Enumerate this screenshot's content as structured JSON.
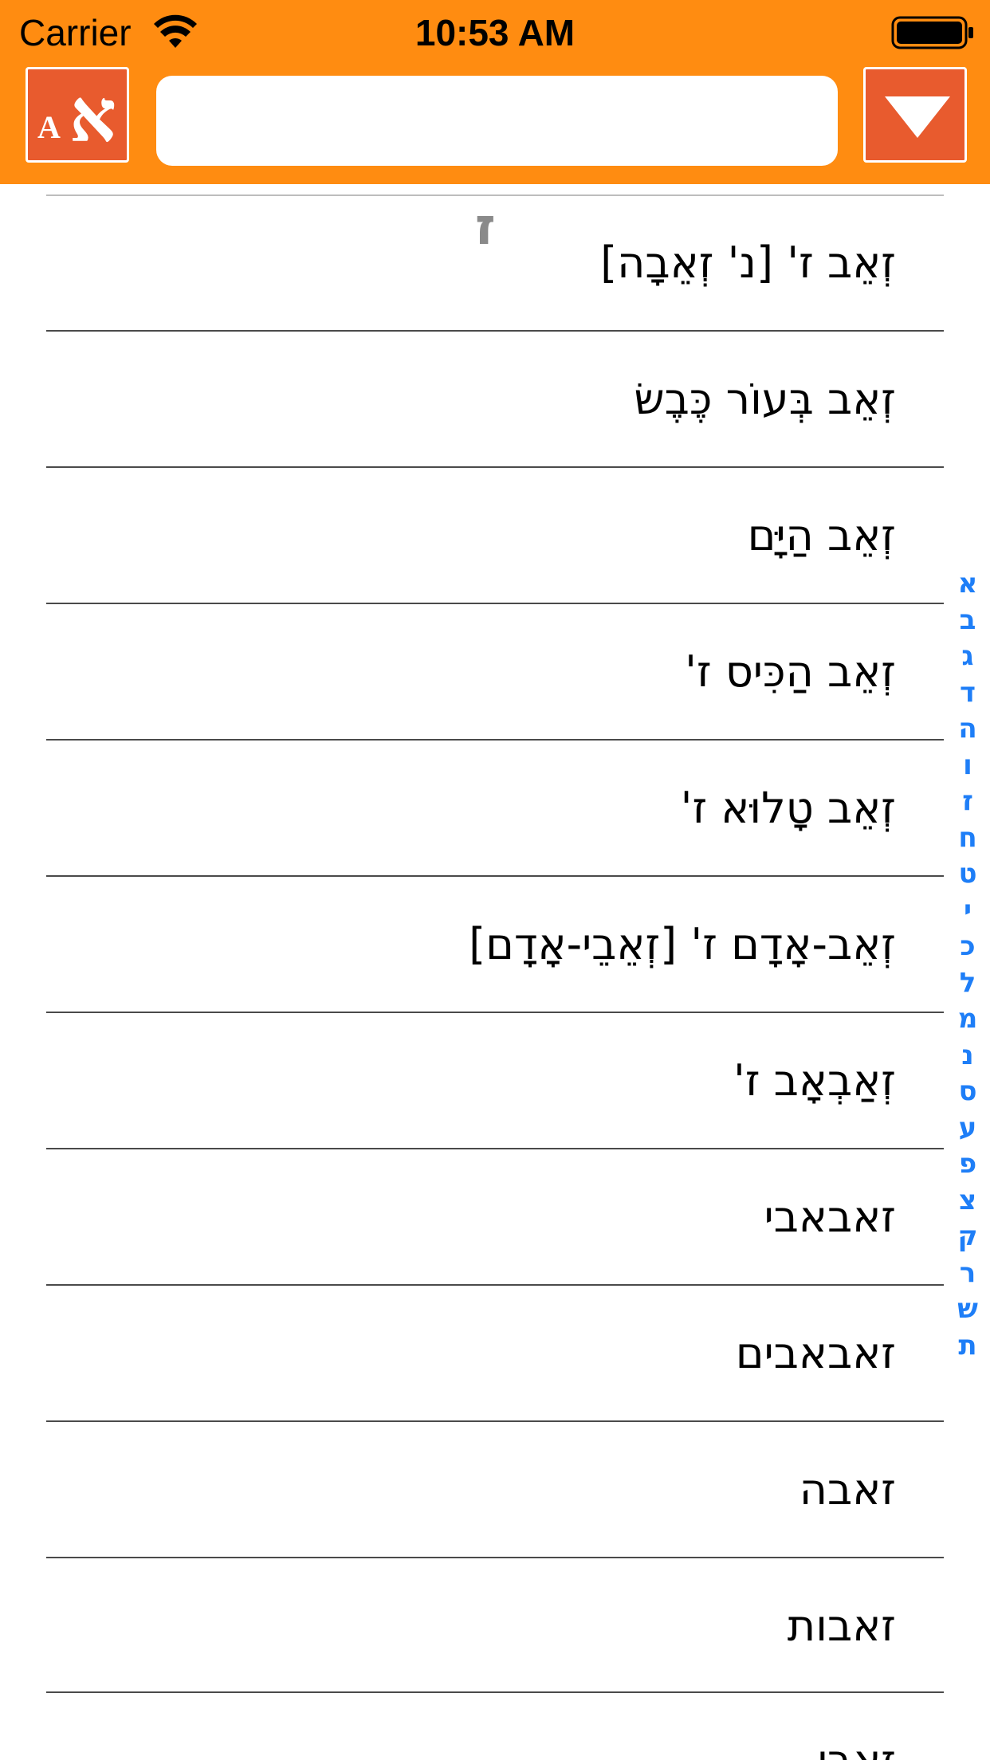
{
  "status_bar": {
    "carrier": "Carrier",
    "time": "10:53 AM"
  },
  "toolbar": {
    "lang_toggle_latin": "A",
    "lang_toggle_hebrew": "א",
    "search_value": "",
    "search_placeholder": "",
    "dropdown_icon": "triangle-down-icon"
  },
  "colors": {
    "header_bg": "#FF8C11",
    "button_bg": "#E85B2E",
    "index_color": "#1E7EF7",
    "section_letter_color": "#8a8a8a"
  },
  "list": {
    "section_letter": "ז",
    "entries": [
      "זְאֵב ז' [נ' זְאֵבָה]",
      "זְאֵב בְּעוֹר כֶּבֶשׂ",
      "זְאֵב הַיָּם",
      "זְאֵב הַכִּיס ז'",
      "זְאֵב טָלוּא ז'",
      "זְאֵב-אָדָם ז' [זְאֵבֵי-אָדָם]",
      "זְאַבְאָב ז'",
      "זאבאבי",
      "זאבאבים",
      "זאבה",
      "זאבות",
      "זאבי"
    ]
  },
  "index_bar": {
    "letters": [
      "א",
      "ב",
      "ג",
      "ד",
      "ה",
      "ו",
      "ז",
      "ח",
      "ט",
      "י",
      "כ",
      "ל",
      "מ",
      "נ",
      "ס",
      "ע",
      "פ",
      "צ",
      "ק",
      "ר",
      "ש",
      "ת"
    ]
  }
}
